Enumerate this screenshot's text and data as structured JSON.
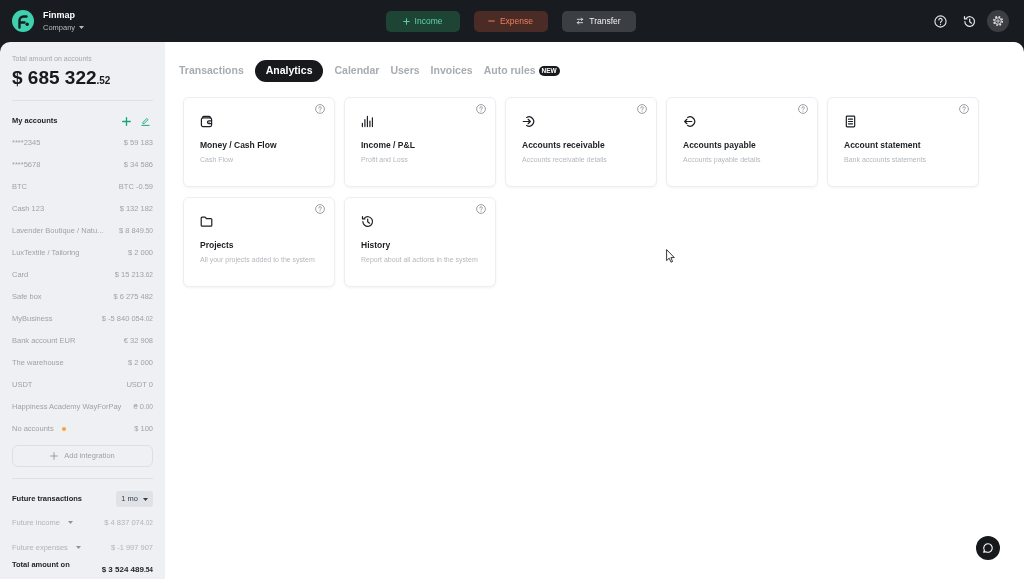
{
  "header": {
    "brand": "Finmap",
    "company": "Company",
    "actions": [
      {
        "kind": "income",
        "label": "Income"
      },
      {
        "kind": "expense",
        "label": "Expense"
      },
      {
        "kind": "transfer",
        "label": "Transfer"
      }
    ]
  },
  "sidebar": {
    "total": {
      "label": "Total amount on accounts",
      "amount": "$ 685 322",
      "cents": ".52"
    },
    "accounts_title": "My accounts",
    "accounts": [
      {
        "name": "****2345",
        "amount": "$ 59 183",
        "alert": false
      },
      {
        "name": "****5678",
        "amount": "$ 34 586",
        "alert": false
      },
      {
        "name": "BTC",
        "amount": "BTC -0.59",
        "alert": false
      },
      {
        "name": "Cash 123",
        "amount": "$ 132 182",
        "alert": false
      },
      {
        "name": "Lavender Boutique / Natu...",
        "amount": "$ 8 849",
        "cents": ".50",
        "alert": false
      },
      {
        "name": "LuxTextile / Tailoring",
        "amount": "$ 2 000",
        "alert": false
      },
      {
        "name": "Card",
        "amount": "$ 15 213",
        "cents": ".62",
        "alert": false
      },
      {
        "name": "Safe box",
        "amount": "$ 6 275 482",
        "alert": false
      },
      {
        "name": "MyBusiness",
        "amount": "$ -5 840 054",
        "cents": ".02",
        "alert": false
      },
      {
        "name": "Bank account EUR",
        "amount": "€ 32 908",
        "alert": false
      },
      {
        "name": "The warehouse",
        "amount": "$ 2 000",
        "alert": false
      },
      {
        "name": "USDT",
        "amount": "USDT 0",
        "alert": false
      },
      {
        "name": "Happiness Academy WayForPay",
        "amount": "₴ 0",
        "cents": ".00",
        "alert": false
      },
      {
        "name": "No accounts",
        "amount": "$ 100",
        "alert": true
      }
    ],
    "add_integration": "Add integration",
    "future": {
      "title": "Future transactions",
      "period": "1 mo",
      "rows": [
        {
          "label": "Future income",
          "amount": "$ 4 837 074",
          "cents": ".02"
        },
        {
          "label": "Future expenses",
          "amount": "$ -1 997 907"
        }
      ],
      "total": {
        "label": "Total amount on",
        "amount": "$ 3 524 489",
        "cents": ".54"
      }
    }
  },
  "tabs": [
    {
      "label": "Transactions",
      "selected": false
    },
    {
      "label": "Analytics",
      "selected": true
    },
    {
      "label": "Calendar",
      "selected": false
    },
    {
      "label": "Users",
      "selected": false
    },
    {
      "label": "Invoices",
      "selected": false
    },
    {
      "label": "Auto rules",
      "selected": false,
      "badge": "NEW"
    }
  ],
  "reports": [
    {
      "kind": "cashflow",
      "title": "Money / Cash Flow",
      "description": "Cash Flow"
    },
    {
      "kind": "pnl",
      "title": "Income / P&L",
      "description": "Profit and Loss"
    },
    {
      "kind": "receivable",
      "title": "Accounts receivable",
      "description": "Accounts receivable details"
    },
    {
      "kind": "payable",
      "title": "Accounts payable",
      "description": "Accounts payable details"
    },
    {
      "kind": "statement",
      "title": "Account statement",
      "description": "Bank accounts statements"
    },
    {
      "kind": "projects",
      "title": "Projects",
      "description": "All your projects added to the system"
    },
    {
      "kind": "history",
      "title": "History",
      "description": "Report about all actions in the system"
    }
  ]
}
